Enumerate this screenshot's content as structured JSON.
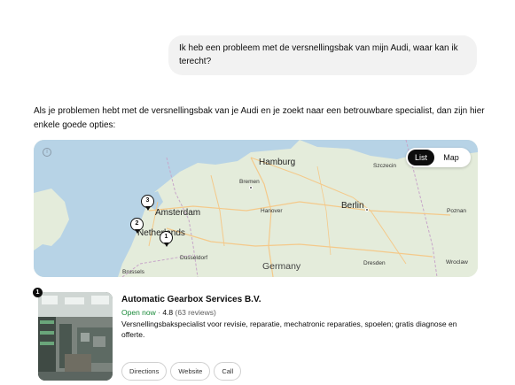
{
  "conversation": {
    "user_message": "Ik heb een probleem met de versnellingsbak van mijn Audi, waar kan ik terecht?",
    "intro": "Als je problemen hebt met de versnellingsbak van je Audi en je zoekt naar een betrouwbare specialist, dan zijn hier enkele goede opties:"
  },
  "map": {
    "info_icon": "i",
    "toggle": {
      "list": "List",
      "map": "Map",
      "selected": "List"
    },
    "labels": {
      "hamburg": "Hamburg",
      "szczecin": "Szczecin",
      "bremen": "Bremen",
      "amsterdam": "Amsterdam",
      "hanover": "Hanover",
      "berlin": "Berlin",
      "poznan": "Poznan",
      "netherlands": "Netherlands",
      "dusseldorf": "Dusseldorf",
      "dresden": "Dresden",
      "wroclaw": "Wroclaw",
      "brussels": "Brussels",
      "germany": "Germany"
    },
    "pins": [
      "3",
      "2",
      "1"
    ],
    "colors": {
      "water": "#b7d3e6",
      "land": "#e4ecdb",
      "roads": "#f4c98a",
      "borders": "#c7a6c9"
    }
  },
  "result": {
    "number": "1",
    "name": "Automatic Gearbox Services B.V.",
    "open_status": "Open now",
    "separator": " · ",
    "rating": "4.8",
    "reviews": "(63 reviews)",
    "description": "Versnellingsbakspecialist voor revisie, reparatie, mechatronic reparaties, spoelen; gratis diagnose en offerte.",
    "actions": {
      "directions": "Directions",
      "website": "Website",
      "call": "Call"
    },
    "status_color": "#1a8a3a"
  }
}
